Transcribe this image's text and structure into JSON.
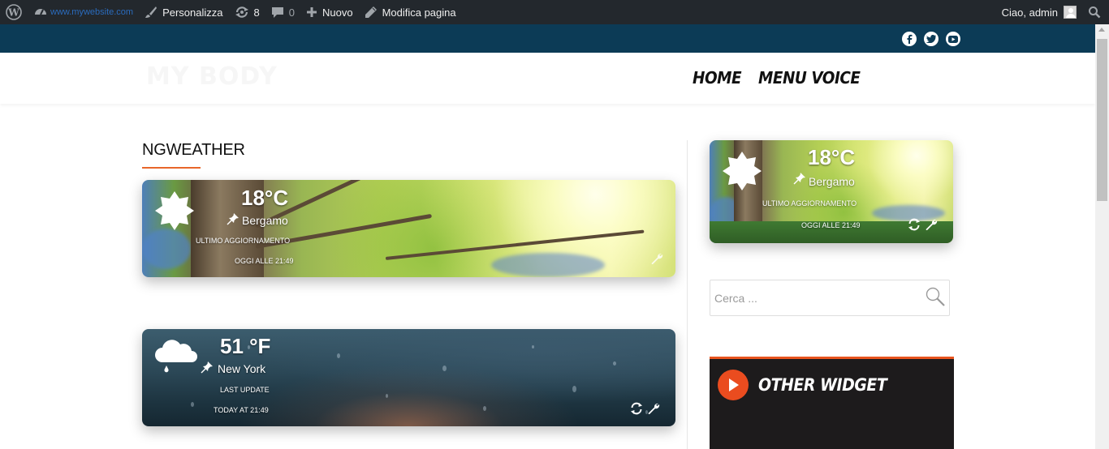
{
  "admin_bar": {
    "site_url": "www.mywebsite.com",
    "customize_label": "Personalizza",
    "updates_count": "8",
    "comments_count": "0",
    "new_label": "Nuovo",
    "edit_page_label": "Modifica pagina",
    "greeting": "Ciao, admin",
    "icons": [
      "wordpress-icon",
      "dashboard-icon",
      "brush-icon",
      "updates-icon",
      "comment-icon",
      "plus-icon",
      "pencil-icon",
      "search-icon"
    ]
  },
  "social": {
    "icons": [
      "facebook-icon",
      "twitter-icon",
      "youtube-icon"
    ],
    "icon_color": "#0c3b56"
  },
  "header": {
    "logo_text": "MY BODY",
    "nav": [
      "HOME",
      "MENU VOICE"
    ]
  },
  "main": {
    "title": "NGWEATHER",
    "accent_color": "#e8662a",
    "weather_cards": [
      {
        "temp": "18°C",
        "city": "Bergamo",
        "update_label": "ULTIMO AGGIORNAMENTO",
        "update_time": "OGGI ALLE 21:49",
        "condition_icon": "sun-icon",
        "background": "forest-sunlight"
      },
      {
        "temp": "51 °F",
        "city": "New York",
        "update_label": "LAST UPDATE",
        "update_time": "TODAY AT 21:49",
        "condition_icon": "rain-cloud-icon",
        "background": "rainy-window"
      }
    ]
  },
  "sidebar": {
    "weather_widget": {
      "temp": "18°C",
      "city": "Bergamo",
      "update_label": "ULTIMO AGGIORNAMENTO",
      "update_time": "OGGI ALLE 21:49",
      "condition_icon": "sun-icon"
    },
    "search": {
      "placeholder": "Cerca ..."
    },
    "other_widget": {
      "title": "OTHER WIDGET",
      "accent_color": "#e8541e"
    }
  }
}
